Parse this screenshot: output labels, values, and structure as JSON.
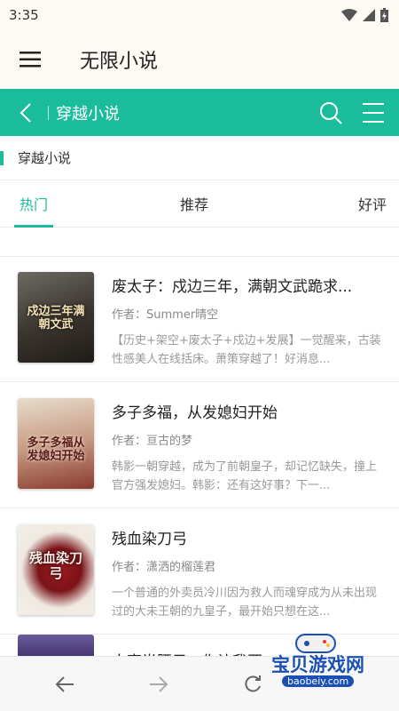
{
  "status": {
    "time": "3:35"
  },
  "app": {
    "title": "无限小说"
  },
  "category": {
    "title": "穿越小说"
  },
  "section": {
    "title": "穿越小说"
  },
  "tabs": [
    {
      "label": "热门",
      "active": true
    },
    {
      "label": "推荐",
      "active": false
    },
    {
      "label": "好评",
      "active": false
    }
  ],
  "books": [
    {
      "title": "废太子：戍边三年，满朝文武跪求...",
      "author": "作者：Summer晴空",
      "desc": "【历史+架空+废太子+戍边+发展】一觉醒来，古装性感美人在线括床。萧策穿越了！好消息...",
      "cover_text": "戍边三年满朝文武",
      "cover_color": "#4a4640"
    },
    {
      "title": "多子多福，从发媳妇开始",
      "author": "作者：亘古的梦",
      "desc": "韩影一朝穿越，成为了前朝皇子，却记忆缺失，撞上官方强发媳妇。韩影：还有这好事？下一...",
      "cover_text": "多子多福从发媳妇开始",
      "cover_color": "#c9b3a0"
    },
    {
      "title": "残血染刀弓",
      "author": "作者：潇洒的榴莲君",
      "desc": "一个普通的外卖员冷川因为救人而魂穿成为从未出现过的大未王朝的九皇子，最开始只想在这...",
      "cover_text": "残血染刀弓",
      "cover_color": "#e9e4de"
    }
  ],
  "partial_book": {
    "title": "人事半腰子，你让我亚..."
  },
  "watermark": {
    "text": "宝贝游戏网",
    "sub": "baobeiy.com"
  },
  "colors": {
    "accent": "#1bbc9b"
  }
}
